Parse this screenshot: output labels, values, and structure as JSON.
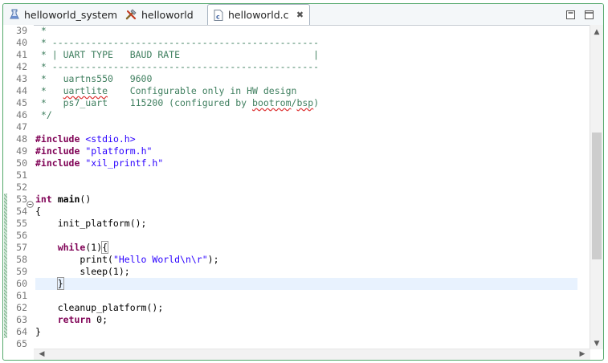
{
  "tabs": [
    {
      "label": "helloworld_system",
      "icon": "system-project-icon",
      "active": false
    },
    {
      "label": "helloworld",
      "icon": "application-project-icon",
      "active": false
    },
    {
      "label": "helloworld.c",
      "icon": "c-file-icon",
      "active": true
    }
  ],
  "window_buttons": [
    "minimize-icon",
    "maximize-icon"
  ],
  "lines": [
    {
      "n": "39",
      "tokens": [
        [
          "com",
          " *"
        ]
      ]
    },
    {
      "n": "40",
      "tokens": [
        [
          "com",
          " * ------------------------------------------------"
        ]
      ]
    },
    {
      "n": "41",
      "tokens": [
        [
          "com",
          " * | UART TYPE   BAUD RATE                        |"
        ]
      ]
    },
    {
      "n": "42",
      "tokens": [
        [
          "com",
          " * ------------------------------------------------"
        ]
      ]
    },
    {
      "n": "43",
      "tokens": [
        [
          "com",
          " *   uartns550   9600"
        ]
      ]
    },
    {
      "n": "44",
      "tokens": [
        [
          "com",
          " *   "
        ],
        [
          "com-ul",
          "uartlite"
        ],
        [
          "com",
          "    Configurable only in HW design"
        ]
      ]
    },
    {
      "n": "45",
      "tokens": [
        [
          "com",
          " *   ps7_uart    115200 (configured by "
        ],
        [
          "com-ul",
          "bootrom"
        ],
        [
          "com",
          "/"
        ],
        [
          "com-ul",
          "bsp"
        ],
        [
          "com",
          ")"
        ]
      ]
    },
    {
      "n": "46",
      "tokens": [
        [
          "com",
          " */"
        ]
      ]
    },
    {
      "n": "47",
      "tokens": []
    },
    {
      "n": "48",
      "tokens": [
        [
          "dir",
          "#include"
        ],
        [
          "txt",
          " "
        ],
        [
          "str",
          "<stdio.h>"
        ]
      ]
    },
    {
      "n": "49",
      "tokens": [
        [
          "dir",
          "#include"
        ],
        [
          "txt",
          " "
        ],
        [
          "str",
          "\"platform.h\""
        ]
      ]
    },
    {
      "n": "50",
      "tokens": [
        [
          "dir",
          "#include"
        ],
        [
          "txt",
          " "
        ],
        [
          "str",
          "\"xil_printf.h\""
        ]
      ]
    },
    {
      "n": "51",
      "tokens": []
    },
    {
      "n": "52",
      "tokens": []
    },
    {
      "n": "53",
      "tokens": [
        [
          "kw",
          "int"
        ],
        [
          "txt",
          " "
        ],
        [
          "fn",
          "main"
        ],
        [
          "txt",
          "()"
        ]
      ],
      "fold": true
    },
    {
      "n": "54",
      "tokens": [
        [
          "txt",
          "{"
        ]
      ]
    },
    {
      "n": "55",
      "tokens": [
        [
          "txt",
          "    init_platform();"
        ]
      ]
    },
    {
      "n": "56",
      "tokens": []
    },
    {
      "n": "57",
      "tokens": [
        [
          "txt",
          "    "
        ],
        [
          "kw",
          "while"
        ],
        [
          "txt",
          "(1)"
        ],
        [
          "brk",
          "{"
        ]
      ]
    },
    {
      "n": "58",
      "tokens": [
        [
          "txt",
          "        print("
        ],
        [
          "str",
          "\"Hello World\\n\\r\""
        ],
        [
          "txt",
          ");"
        ]
      ]
    },
    {
      "n": "59",
      "tokens": [
        [
          "txt",
          "        sleep(1);"
        ]
      ]
    },
    {
      "n": "60",
      "tokens": [
        [
          "txt",
          "    "
        ],
        [
          "brk",
          "}"
        ],
        [
          "caret",
          ""
        ]
      ],
      "current": true
    },
    {
      "n": "61",
      "tokens": []
    },
    {
      "n": "62",
      "tokens": [
        [
          "txt",
          "    cleanup_platform();"
        ]
      ]
    },
    {
      "n": "63",
      "tokens": [
        [
          "txt",
          "    "
        ],
        [
          "kw",
          "return"
        ],
        [
          "txt",
          " 0;"
        ]
      ]
    },
    {
      "n": "64",
      "tokens": [
        [
          "txt",
          "}"
        ]
      ]
    },
    {
      "n": "65",
      "tokens": []
    }
  ],
  "fold_icon": "collapse-minus-icon",
  "scrollbar": {
    "vertical_position": 0.55,
    "visible_fraction": 0.42
  },
  "colors": {
    "comment": "#3f7f5f",
    "keyword": "#7f0055",
    "string": "#2a00ff",
    "current_line": "#e8f2fe",
    "frame_border": "#53a86b"
  }
}
